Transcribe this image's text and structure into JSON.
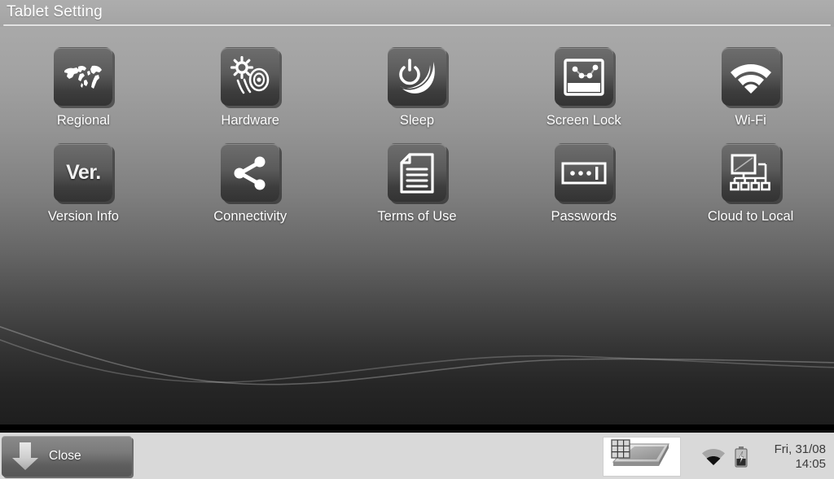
{
  "window": {
    "title": "Tablet Setting"
  },
  "settings_grid": {
    "rows": [
      [
        {
          "label": "Regional",
          "icon": "world-map-icon"
        },
        {
          "label": "Hardware",
          "icon": "brightness-volume-icon"
        },
        {
          "label": "Sleep",
          "icon": "power-moon-icon"
        },
        {
          "label": "Screen Lock",
          "icon": "screen-pattern-lock-icon"
        },
        {
          "label": "Wi-Fi",
          "icon": "wifi-icon"
        }
      ],
      [
        {
          "label": "Version Info",
          "icon": "version-text-icon",
          "icon_text": "Ver."
        },
        {
          "label": "Connectivity",
          "icon": "share-nodes-icon"
        },
        {
          "label": "Terms of Use",
          "icon": "document-lines-icon"
        },
        {
          "label": "Passwords",
          "icon": "password-field-icon"
        },
        {
          "label": "Cloud to Local",
          "icon": "network-server-icon"
        }
      ]
    ]
  },
  "taskbar": {
    "close_label": "Close",
    "close_icon": "down-arrow-icon",
    "tablet_icon": "tablet-device-icon",
    "wifi_icon": "wifi-status-icon",
    "battery_icon": "battery-charging-icon",
    "clock": {
      "date": "Fri, 31/08",
      "time": "14:05"
    }
  },
  "colors": {
    "titlebar": "#a8a8a8",
    "taskbar": "#d9d9d9",
    "tile": "#5a5a5a",
    "label_text": "#ffffff",
    "clock_text": "#3b3b3b"
  }
}
